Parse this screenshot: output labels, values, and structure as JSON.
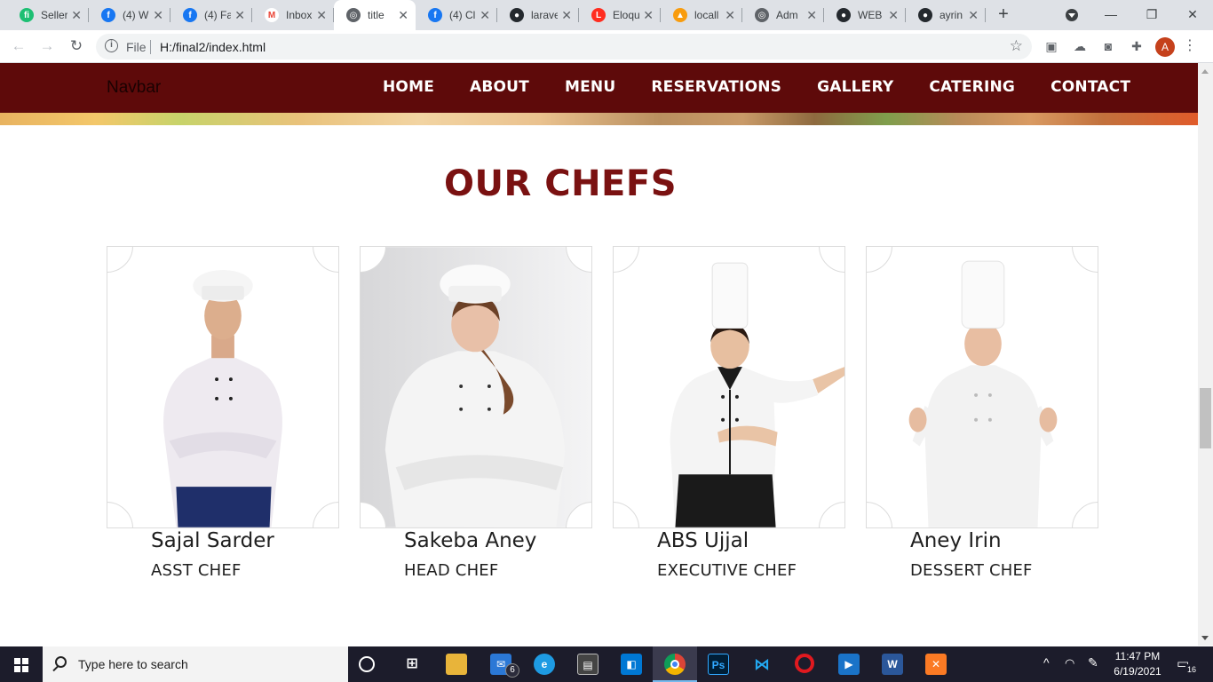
{
  "browser": {
    "tabs": [
      {
        "title": "Seller",
        "icon": "fiverr-icon",
        "color": "#1dbf73",
        "glyph": "fi"
      },
      {
        "title": "(4) W",
        "icon": "facebook-icon",
        "color": "#1877f2",
        "glyph": "f"
      },
      {
        "title": "(4) Fa",
        "icon": "facebook-icon",
        "color": "#1877f2",
        "glyph": "f"
      },
      {
        "title": "Inbox",
        "icon": "gmail-icon",
        "color": "#ea4335",
        "glyph": "M"
      },
      {
        "title": "title",
        "icon": "globe-icon",
        "color": "#5f6368",
        "glyph": "◎",
        "active": true
      },
      {
        "title": "(4) Cl",
        "icon": "facebook-icon",
        "color": "#1877f2",
        "glyph": "f"
      },
      {
        "title": "larave",
        "icon": "github-icon",
        "color": "#24292e",
        "glyph": "●"
      },
      {
        "title": "Eloqu",
        "icon": "laravel-icon",
        "color": "#ff2d20",
        "glyph": "L"
      },
      {
        "title": "locall",
        "icon": "phpmyadmin-icon",
        "color": "#f89c0e",
        "glyph": "▲"
      },
      {
        "title": "Adm",
        "icon": "globe-icon",
        "color": "#5f6368",
        "glyph": "◎"
      },
      {
        "title": "WEB",
        "icon": "github-icon",
        "color": "#24292e",
        "glyph": "●"
      },
      {
        "title": "ayrin",
        "icon": "github-icon",
        "color": "#24292e",
        "glyph": "●"
      }
    ],
    "address": {
      "scheme_label": "File",
      "url": "H:/final2/index.html"
    },
    "profile_initial": "A"
  },
  "site": {
    "brand": "Navbar",
    "nav": [
      "HOME",
      "ABOUT",
      "MENU",
      "RESERVATIONS",
      "GALLERY",
      "CATERING",
      "CONTACT"
    ],
    "section_title": "OUR CHEFS",
    "chefs": [
      {
        "name": "Sajal Sarder",
        "role": "ASST CHEF"
      },
      {
        "name": "Sakeba Aney",
        "role": "HEAD CHEF"
      },
      {
        "name": "ABS Ujjal",
        "role": "EXECUTIVE CHEF"
      },
      {
        "name": "Aney Irin",
        "role": "DESSERT CHEF"
      }
    ]
  },
  "taskbar": {
    "search_placeholder": "Type here to search",
    "mail_badge": "6",
    "time": "11:47 PM",
    "date": "6/19/2021",
    "notification_count": "16"
  }
}
